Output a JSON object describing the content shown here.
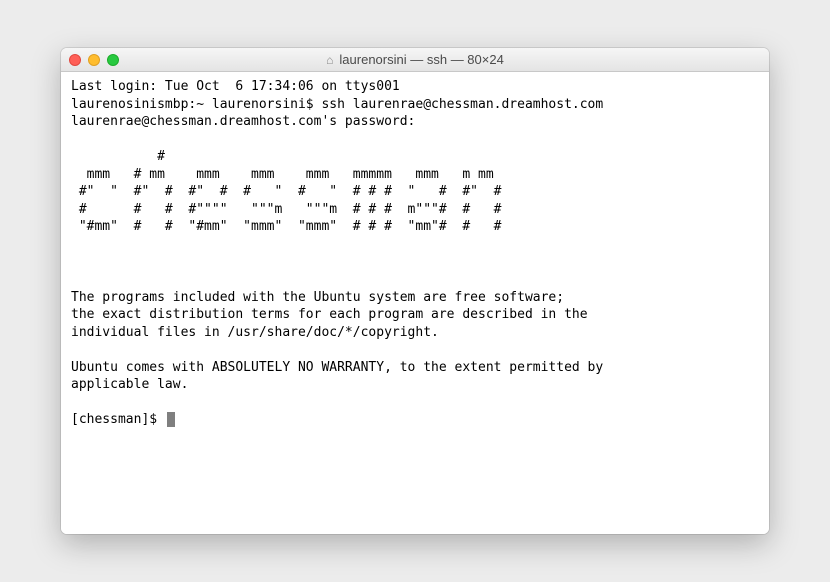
{
  "window": {
    "title": "laurenorsini — ssh — 80×24"
  },
  "terminal": {
    "line1": "Last login: Tue Oct  6 17:34:06 on ttys001",
    "line2": "laurenosinismbp:~ laurenorsini$ ssh laurenrae@chessman.dreamhost.com",
    "line3": "laurenrae@chessman.dreamhost.com's password:",
    "art1": "           #",
    "art2": "  mmm   # mm    mmm    mmm    mmm   mmmmm   mmm   m mm",
    "art3": " #\"  \"  #\"  #  #\"  #  #   \"  #   \"  # # #  \"   #  #\"  #",
    "art4": " #      #   #  #\"\"\"\"   \"\"\"m   \"\"\"m  # # #  m\"\"\"#  #   #",
    "art5": " \"#mm\"  #   #  \"#mm\"  \"mmm\"  \"mmm\"  # # #  \"mm\"#  #   #",
    "msg1": "The programs included with the Ubuntu system are free software;",
    "msg2": "the exact distribution terms for each program are described in the",
    "msg3": "individual files in /usr/share/doc/*/copyright.",
    "msg4": "Ubuntu comes with ABSOLUTELY NO WARRANTY, to the extent permitted by",
    "msg5": "applicable law.",
    "prompt": "[chessman]$ "
  }
}
